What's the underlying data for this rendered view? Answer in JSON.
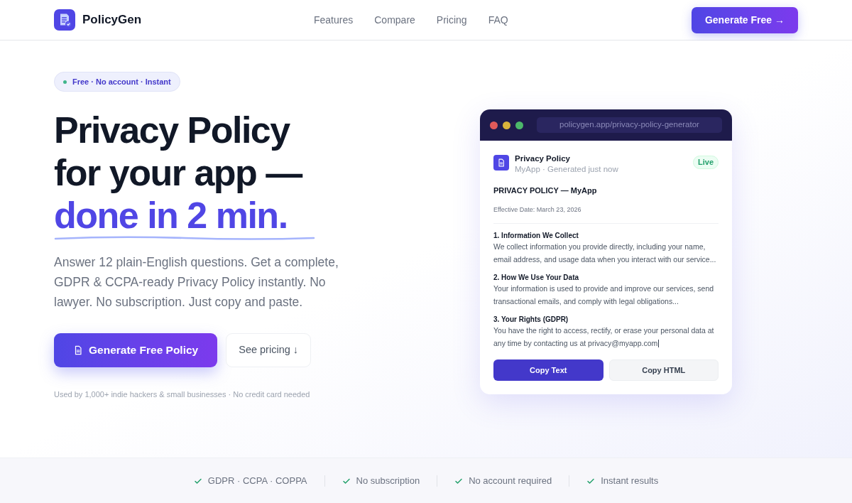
{
  "brand": {
    "name": "PolicyGen"
  },
  "nav": [
    {
      "label": "Features"
    },
    {
      "label": "Compare"
    },
    {
      "label": "Pricing"
    },
    {
      "label": "FAQ"
    }
  ],
  "header_cta": "Generate Free →",
  "hero": {
    "badge": "Free · No account · Instant",
    "headline": [
      "Privacy Policy",
      "for your app —"
    ],
    "highlight": "done in 2 min.",
    "subtitle": "Answer 12 plain-English questions. Get a complete, GDPR & CCPA-ready Privacy Policy instantly. No lawyer. No subscription. Just copy and paste.",
    "primary_button": "Generate Free Policy",
    "secondary_button": "See pricing ↓",
    "note": "Used by 1,000+ indie hackers & small businesses · No credit card needed"
  },
  "preview": {
    "url": "policygen.app/privacy-policy-generator",
    "doc_title": "Privacy Policy",
    "doc_subtitle": "MyApp · Generated just now",
    "status": "Live",
    "heading": "PRIVACY POLICY — MyApp",
    "effective": "Effective Date: March 23, 2026",
    "sections": [
      {
        "title": "1. Information We Collect",
        "body": "We collect information you provide directly, including your name, email address, and usage data when you interact with our service..."
      },
      {
        "title": "2. How We Use Your Data",
        "body": "Your information is used to provide and improve our services, send transactional emails, and comply with legal obligations..."
      },
      {
        "title": "3. Your Rights (GDPR)",
        "body": "You have the right to access, rectify, or erase your personal data at any time by contacting us at privacy@myapp.com"
      }
    ],
    "buttons": [
      {
        "label": "Copy Text",
        "kind": "primary"
      },
      {
        "label": "Copy HTML",
        "kind": "secondary"
      }
    ]
  },
  "trust": [
    "GDPR · CCPA · COPPA",
    "No subscription",
    "No account required",
    "Instant results"
  ]
}
